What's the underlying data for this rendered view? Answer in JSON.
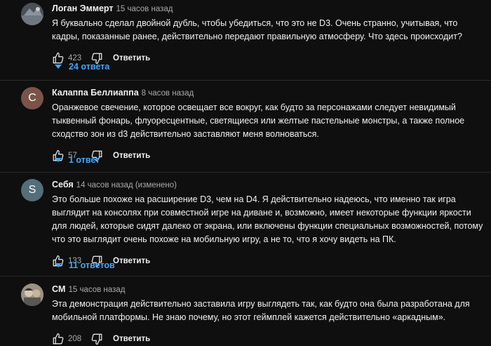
{
  "comments": [
    {
      "author": "Логан Эммерт",
      "time": "15 часов назад",
      "text": "Я буквально сделал двойной дубль, чтобы убедиться, что это не D3. Очень странно, учитывая, что кадры, показанные ранее, действительно передают правильную атмосферу. Что здесь происходит?",
      "likes": "423",
      "reply_label": "Ответить",
      "replies_label": "24 ответа",
      "avatar_color": "#6b7078"
    },
    {
      "author": "Калаппа Беллиаппа",
      "time": "8 часов назад",
      "avatar_letter": "C",
      "text": "Оранжевое свечение, которое освещает все вокруг, как будто за персонажами следует невидимый тыквенный фонарь, флуоресцентные, светящиеся или желтые пастельные монстры, а также полное сходство зон из d3 действительно заставляют меня волноваться.",
      "likes": "57",
      "reply_label": "Ответить",
      "replies_label": "1 ответ",
      "avatar_color": "#7a5448"
    },
    {
      "author": "Себя",
      "time": "14 часов назад (изменено)",
      "avatar_letter": "S",
      "text": "Это больше похоже на расширение D3, чем на D4. Я действительно надеюсь, что именно так игра выглядит на консолях при совместной игре на диване и, возможно, имеет некоторые функции яркости для людей, которые сидят далеко от экрана, или включены функции специальных возможностей, потому что это выглядит очень похоже на мобильную игру, а не то, что я хочу видеть на ПК.",
      "likes": "133",
      "reply_label": "Ответить",
      "replies_label": "11 ответов",
      "avatar_color": "#546e7a"
    },
    {
      "author": "CM",
      "time": "15 часов назад",
      "text": "Эта демонстрация действительно заставила игру выглядеть так, как будто она была разработана для мобильной платформы. Не знаю почему, но этот геймплей кажется действительно «аркадным».",
      "likes": "208",
      "reply_label": "Ответить",
      "avatar_color": "#8a8478"
    }
  ],
  "icons": {
    "like": "thumb-up-icon",
    "dislike": "thumb-down-icon",
    "expand": "chevron-down-icon"
  },
  "colors": {
    "background": "#0f0f0f",
    "text": "#f1f1f1",
    "secondary_text": "#aaaaaa",
    "link_blue": "#3ea6ff",
    "divider": "#2a2a2a"
  }
}
